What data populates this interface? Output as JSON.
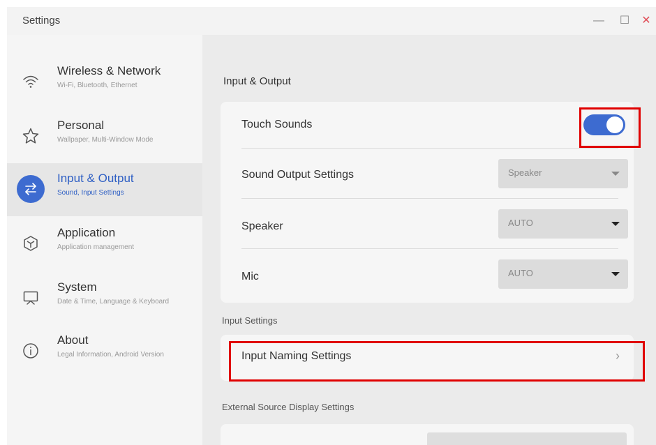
{
  "window": {
    "title": "Settings",
    "controls": {
      "minimize": "—",
      "maximize": "☐",
      "close": "✕"
    }
  },
  "sidebar": {
    "items": [
      {
        "label": "Wireless & Network",
        "sub": "Wi-Fi, Bluetooth, Ethernet",
        "icon": "wifi-icon",
        "active": false
      },
      {
        "label": "Personal",
        "sub": "Wallpaper, Multi-Window Mode",
        "icon": "star-icon",
        "active": false
      },
      {
        "label": "Input & Output",
        "sub": "Sound, Input Settings",
        "icon": "swap-arrows-icon",
        "active": true
      },
      {
        "label": "Application",
        "sub": "Application management",
        "icon": "hexagon-icon",
        "active": false
      },
      {
        "label": "System",
        "sub": "Date & Time, Language & Keyboard",
        "icon": "monitor-icon",
        "active": false
      },
      {
        "label": "About",
        "sub": "Legal Information, Android Version",
        "icon": "info-icon",
        "active": false
      }
    ]
  },
  "main": {
    "section_title": "Input & Output",
    "rows": {
      "touch_sounds": {
        "label": "Touch Sounds",
        "toggle_on": true
      },
      "sound_output": {
        "label": "Sound Output Settings",
        "value": "Speaker"
      },
      "speaker": {
        "label": "Speaker",
        "value": "AUTO"
      },
      "mic": {
        "label": "Mic",
        "value": "AUTO"
      }
    },
    "input_settings": {
      "heading": "Input Settings",
      "naming_label": "Input Naming Settings",
      "chevron": "›"
    },
    "external": {
      "heading": "External Source Display Settings"
    }
  },
  "colors": {
    "accent": "#3d6bd0",
    "highlight": "#e00000",
    "window_bg": "#ebebeb",
    "sidebar_bg": "#f5f5f5"
  }
}
